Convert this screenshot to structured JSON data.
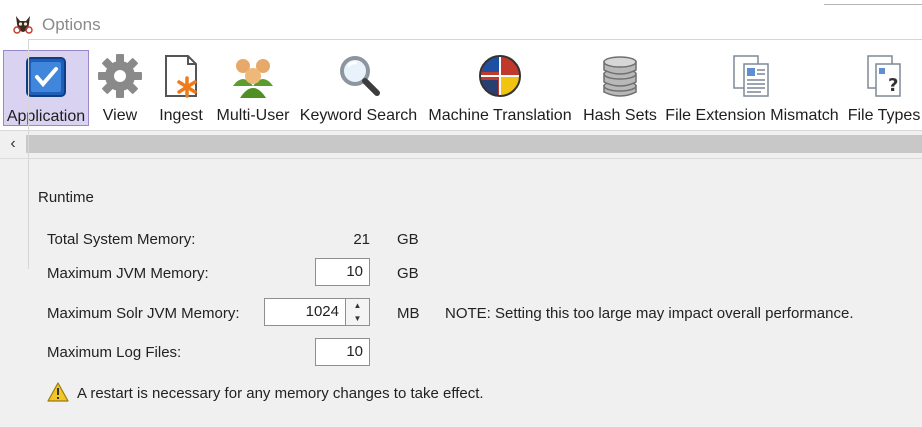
{
  "window": {
    "title": "Options"
  },
  "toolbar": {
    "items": [
      {
        "label": "Application",
        "icon": "application-checkbox-icon",
        "selected": true
      },
      {
        "label": "View",
        "icon": "gear-icon"
      },
      {
        "label": "Ingest",
        "icon": "ingest-document-icon"
      },
      {
        "label": "Multi-User",
        "icon": "users-group-icon"
      },
      {
        "label": "Keyword Search",
        "icon": "magnifier-icon"
      },
      {
        "label": "Machine Translation",
        "icon": "globe-flags-icon"
      },
      {
        "label": "Hash Sets",
        "icon": "database-icon"
      },
      {
        "label": "File Extension Mismatch",
        "icon": "documents-icon"
      },
      {
        "label": "File Types",
        "icon": "file-question-icon"
      }
    ]
  },
  "runtime": {
    "title": "Runtime",
    "total_memory": {
      "label": "Total System Memory:",
      "value": "21",
      "unit": "GB"
    },
    "max_jvm": {
      "label": "Maximum JVM Memory:",
      "value": "10",
      "unit": "GB"
    },
    "max_solr": {
      "label": "Maximum Solr JVM Memory:",
      "value": "1024",
      "unit": "MB",
      "note": "NOTE:  Setting this too large may impact overall performance."
    },
    "max_log": {
      "label": "Maximum Log Files:",
      "value": "10"
    },
    "warning": "A restart is necessary for any memory changes to take effect."
  },
  "colors": {
    "selected_bg": "#d9d2f0",
    "selected_border": "#9b88c9",
    "scroll_track": "#c8c8c8",
    "warning": "#f3c623"
  }
}
